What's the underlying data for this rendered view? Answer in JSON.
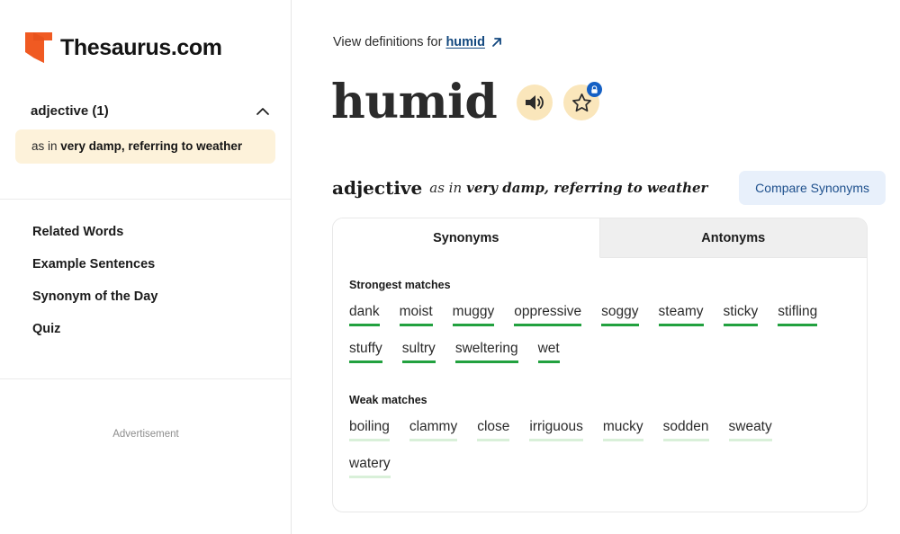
{
  "brand": {
    "name": "Thesaurus.com",
    "logo_icon": "thesaurus-t-logo",
    "logo_color": "#f05a22"
  },
  "sidebar": {
    "pos_section": {
      "title": "adjective (1)",
      "collapse_icon": "chevron-up-icon"
    },
    "senses": [
      {
        "prefix": "as in ",
        "text": "very damp, referring to weather"
      }
    ],
    "nav_items": [
      {
        "label": "Related Words"
      },
      {
        "label": "Example Sentences"
      },
      {
        "label": "Synonym of the Day"
      },
      {
        "label": "Quiz"
      }
    ],
    "ad_label": "Advertisement"
  },
  "main": {
    "definitions_line": {
      "prefix": "View definitions for",
      "link_text": "humid",
      "external_icon": "external-link-arrow-icon"
    },
    "headword": "humid",
    "audio_button": {
      "icon": "speaker-icon"
    },
    "save_button": {
      "icon": "star-icon",
      "badge_icon": "lock-icon",
      "badge_color": "#1560c4"
    },
    "sense": {
      "part_of_speech": "adjective",
      "as_in": "as in",
      "description": "very damp, referring to weather",
      "compare_label": "Compare Synonyms"
    },
    "tabs": [
      {
        "label": "Synonyms",
        "active": true
      },
      {
        "label": "Antonyms",
        "active": false
      }
    ],
    "groups": [
      {
        "title": "Strongest matches",
        "strength": "strong",
        "accent": "#22a13f",
        "words": [
          "dank",
          "moist",
          "muggy",
          "oppressive",
          "soggy",
          "steamy",
          "sticky",
          "stifling",
          "stuffy",
          "sultry",
          "sweltering",
          "wet"
        ]
      },
      {
        "title": "Weak matches",
        "strength": "weak",
        "accent": "#d9f0d9",
        "words": [
          "boiling",
          "clammy",
          "close",
          "irriguous",
          "mucky",
          "sodden",
          "sweaty",
          "watery"
        ]
      }
    ]
  }
}
